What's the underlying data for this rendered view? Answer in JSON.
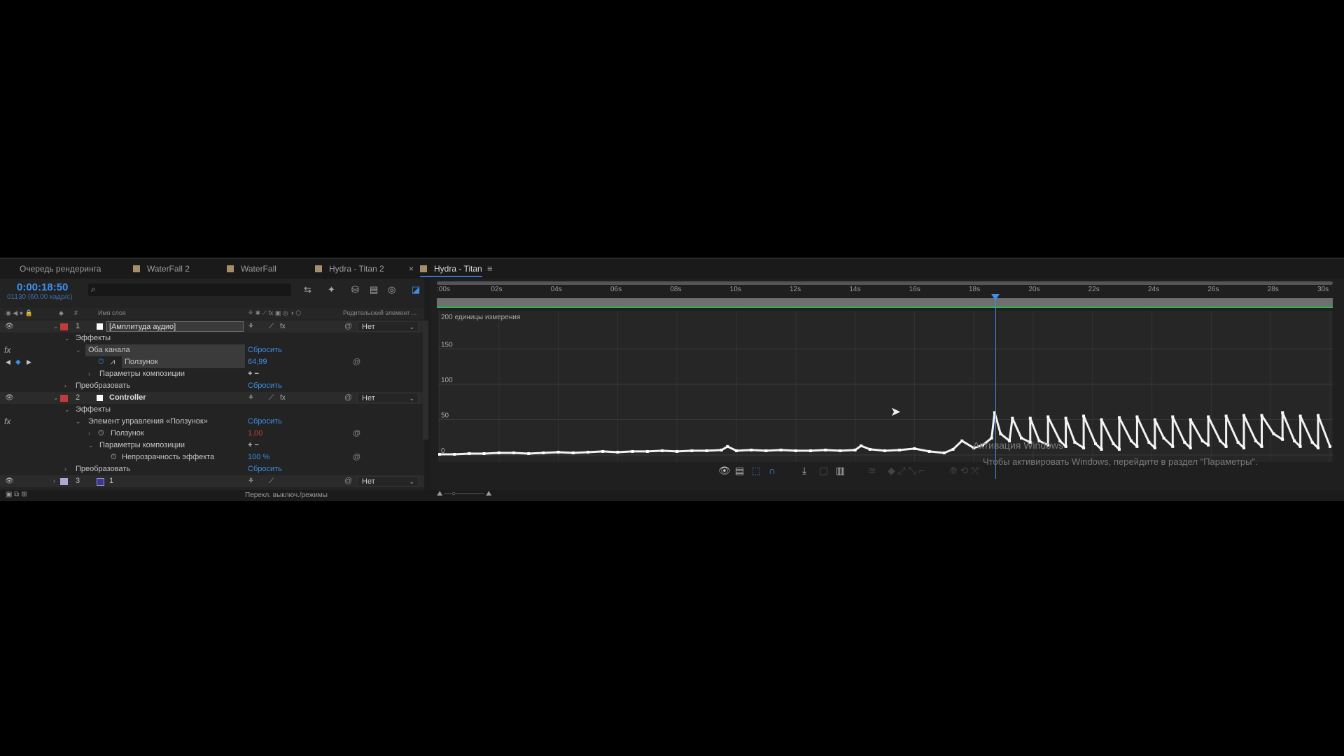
{
  "tabs": [
    {
      "label": "Очередь рендеринга",
      "swatch": false
    },
    {
      "label": "WaterFall 2",
      "swatch": true
    },
    {
      "label": "WaterFall",
      "swatch": true
    },
    {
      "label": "Hydra - Titan 2",
      "swatch": true
    },
    {
      "label": "Hydra - Titan",
      "swatch": true,
      "active": true
    }
  ],
  "timeline": {
    "timecode": "0:00:18:50",
    "fps": "01130 (60.00 кадр/с)",
    "search_placeholder": "",
    "columns": {
      "hash": "#",
      "layer_name": "Имя слоя",
      "parent": "Родительский элемент ..."
    }
  },
  "layers": {
    "l1": {
      "num": "1",
      "name": "[Амплитуда аудио]",
      "parent": "Нет",
      "color": "#c33a3a"
    },
    "l1_effects": "Эффекты",
    "l1_both_channels": "Оба канала",
    "l1_reset": "Сбросить",
    "l1_slider": "Ползунок",
    "l1_slider_value": "64,99",
    "l1_comp_params": "Параметры композиции",
    "l1_transform": "Преобразовать",
    "l1_transform_reset": "Сбросить",
    "l2": {
      "num": "2",
      "name": "Controller",
      "parent": "Нет",
      "color": "#c33a3a"
    },
    "l2_effects": "Эффекты",
    "l2_slider_control": "Элемент управления «Ползунок»",
    "l2_reset": "Сбросить",
    "l2_slider": "Ползунок",
    "l2_slider_value": "1,00",
    "l2_comp_params": "Параметры композиции",
    "l2_opacity": "Непрозрачность эффекта",
    "l2_opacity_value": "100 %",
    "l2_transform": "Преобразовать",
    "l2_transform_reset": "Сбросить",
    "l3": {
      "num": "3",
      "name": "1",
      "parent": "Нет",
      "color": "#a9a9d6"
    },
    "plus_minus": "+ −"
  },
  "bottom_bar": {
    "toggle_label": "Перекл. выключ./режимы"
  },
  "ruler_ticks": [
    ":00s",
    "02s",
    "04s",
    "06s",
    "08s",
    "10s",
    "12s",
    "14s",
    "16s",
    "18s",
    "20s",
    "22s",
    "24s",
    "26s",
    "28s",
    "30s"
  ],
  "graph": {
    "units_label": "200 единицы измерения",
    "y_labels": [
      "150",
      "100",
      "50",
      "0"
    ]
  },
  "watermark": {
    "line1": "Активация Windows",
    "line2": "Чтобы активировать Windows, перейдите в раздел \"Параметры\"."
  },
  "chart_data": {
    "type": "line",
    "title": "",
    "xlabel": "",
    "ylabel": "",
    "x_unit": "s",
    "ylim": [
      0,
      200
    ],
    "xlim": [
      0,
      30
    ],
    "series": [
      {
        "values": [
          [
            0,
            1
          ],
          [
            0.5,
            1
          ],
          [
            1,
            2
          ],
          [
            1.5,
            2
          ],
          [
            2,
            3
          ],
          [
            2.5,
            3
          ],
          [
            3,
            2
          ],
          [
            3.5,
            3
          ],
          [
            4,
            4
          ],
          [
            4.5,
            3
          ],
          [
            5,
            4
          ],
          [
            5.5,
            5
          ],
          [
            6,
            4
          ],
          [
            6.5,
            5
          ],
          [
            7,
            5
          ],
          [
            7.5,
            6
          ],
          [
            8,
            5
          ],
          [
            8.5,
            6
          ],
          [
            9,
            6
          ],
          [
            9.5,
            7
          ],
          [
            9.7,
            12
          ],
          [
            10,
            6
          ],
          [
            10.5,
            7
          ],
          [
            11,
            6
          ],
          [
            11.5,
            7
          ],
          [
            12,
            6
          ],
          [
            12.5,
            6
          ],
          [
            13,
            7
          ],
          [
            13.5,
            6
          ],
          [
            14,
            7
          ],
          [
            14.2,
            13
          ],
          [
            14.5,
            8
          ],
          [
            15,
            6
          ],
          [
            15.5,
            7
          ],
          [
            16,
            9
          ],
          [
            16.5,
            5
          ],
          [
            17,
            3
          ],
          [
            17.3,
            8
          ],
          [
            17.6,
            20
          ],
          [
            18,
            10
          ],
          [
            18.3,
            14
          ],
          [
            18.6,
            24
          ],
          [
            18.7,
            60
          ],
          [
            18.9,
            30
          ],
          [
            19.2,
            20
          ],
          [
            19.3,
            52
          ],
          [
            19.6,
            24
          ],
          [
            19.9,
            18
          ],
          [
            19.9,
            52
          ],
          [
            20.2,
            20
          ],
          [
            20.5,
            14
          ],
          [
            20.5,
            54
          ],
          [
            20.9,
            20
          ],
          [
            21.1,
            12
          ],
          [
            21.1,
            52
          ],
          [
            21.4,
            18
          ],
          [
            21.7,
            10
          ],
          [
            21.7,
            55
          ],
          [
            22.1,
            16
          ],
          [
            22.3,
            8
          ],
          [
            22.3,
            50
          ],
          [
            22.7,
            16
          ],
          [
            22.9,
            8
          ],
          [
            22.9,
            53
          ],
          [
            23.3,
            20
          ],
          [
            23.5,
            12
          ],
          [
            23.5,
            54
          ],
          [
            23.9,
            18
          ],
          [
            24.1,
            10
          ],
          [
            24.1,
            50
          ],
          [
            24.4,
            24
          ],
          [
            24.7,
            12
          ],
          [
            24.7,
            54
          ],
          [
            25.1,
            18
          ],
          [
            25.3,
            10
          ],
          [
            25.3,
            50
          ],
          [
            25.7,
            20
          ],
          [
            25.9,
            14
          ],
          [
            25.9,
            54
          ],
          [
            26.3,
            20
          ],
          [
            26.5,
            12
          ],
          [
            26.5,
            55
          ],
          [
            26.9,
            18
          ],
          [
            27.1,
            10
          ],
          [
            27.1,
            56
          ],
          [
            27.5,
            20
          ],
          [
            27.7,
            12
          ],
          [
            27.7,
            56
          ],
          [
            28.1,
            30
          ],
          [
            28.4,
            22
          ],
          [
            28.4,
            60
          ],
          [
            28.8,
            20
          ],
          [
            29.0,
            12
          ],
          [
            29.0,
            55
          ],
          [
            29.4,
            18
          ],
          [
            29.6,
            10
          ],
          [
            29.6,
            56
          ],
          [
            30,
            12
          ]
        ]
      }
    ]
  }
}
